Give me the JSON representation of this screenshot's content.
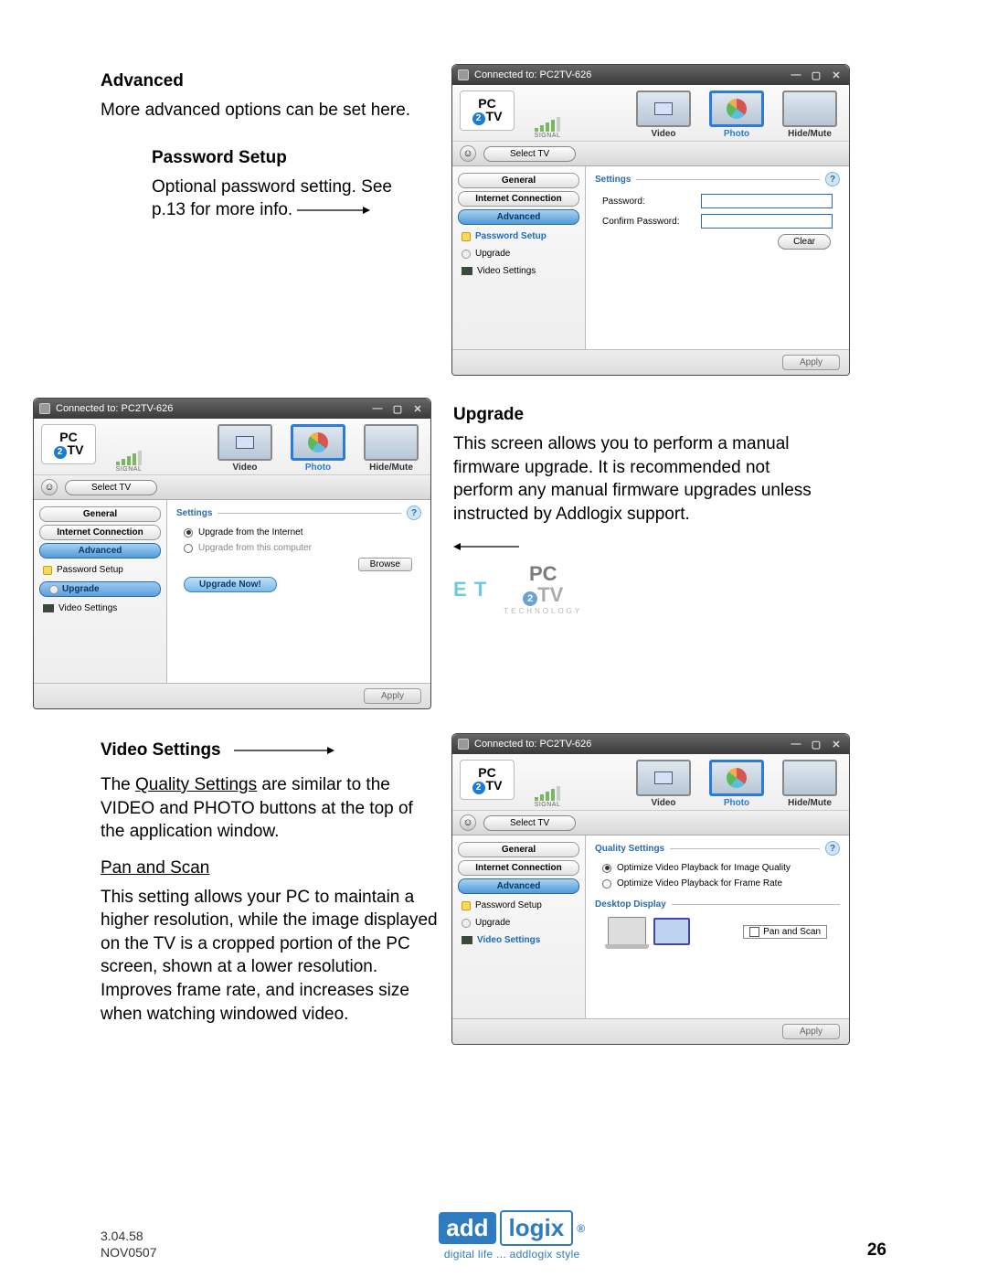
{
  "doc": {
    "advanced_title": "Advanced",
    "advanced_text": "More advanced options can be set here.",
    "password_title": "Password Setup",
    "password_text1": "Optional password setting.  See",
    "password_text2": "p.13 for more info.",
    "upgrade_title": "Upgrade",
    "upgrade_text": "This screen allows you to perform a manual firmware upgrade.  It is recommended not perform any manual firmware upgrades unless instructed by Addlogix support.",
    "video_title": "Video Settings",
    "video_text1a": "The ",
    "video_text1b": "Quality Settings",
    "video_text1c": " are similar to the VIDEO and PHOTO buttons at the top of the application window.",
    "panscan_title": "Pan and Scan",
    "panscan_text": "This setting allows your PC to maintain a higher resolution, while the image displayed on the TV is a cropped portion of the PC screen, shown at a lower resolution.  Improves frame rate, and increases size when watching windowed video."
  },
  "app": {
    "titlebar": "Connected to: PC2TV-626",
    "signal_label": "SIGNAL",
    "select_tv": "Select TV",
    "modes": {
      "video": "Video",
      "photo": "Photo",
      "hidemute": "Hide/Mute"
    },
    "side": {
      "general": "General",
      "internet": "Internet Connection",
      "advanced": "Advanced",
      "password": "Password Setup",
      "upgrade": "Upgrade",
      "video": "Video Settings"
    },
    "apply": "Apply",
    "help": "?"
  },
  "panel1": {
    "heading": "Settings",
    "password_label": "Password:",
    "confirm_label": "Confirm Password:",
    "clear": "Clear",
    "password_value": "",
    "confirm_value": ""
  },
  "panel2": {
    "heading": "Settings",
    "opt_internet": "Upgrade from the Internet",
    "opt_computer": "Upgrade from this computer",
    "browse": "Browse",
    "upgrade_now": "Upgrade Now!"
  },
  "panel3": {
    "heading1": "Quality Settings",
    "opt_quality": "Optimize Video Playback for Image Quality",
    "opt_framerate": "Optimize Video Playback for Frame Rate",
    "heading2": "Desktop Display",
    "panscan": "Pan and Scan"
  },
  "footer": {
    "version": "3.04.58",
    "date": "NOV0507",
    "page": "26",
    "logo_add": "add",
    "logo_logix": "logix",
    "tagline": "digital life ... addlogix style",
    "reg": "®"
  },
  "watermark": {
    "et": "E T",
    "pc": "PC",
    "tv": "TV",
    "tag": "TECHNOLOGY"
  }
}
